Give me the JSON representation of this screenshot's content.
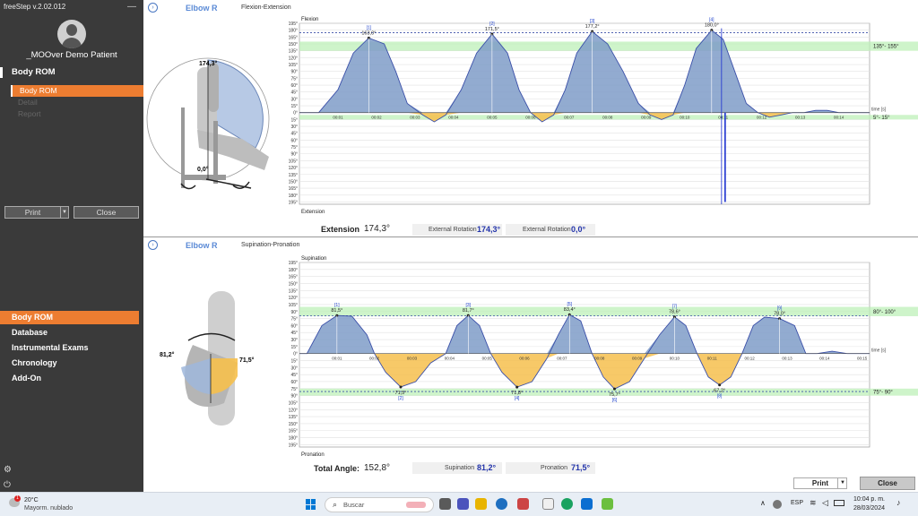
{
  "app": {
    "title": "freeStep v.2.02.012",
    "collapse_glyph": "—"
  },
  "sidebar": {
    "patient_name": "_MOOver Demo Patient",
    "section_title": "Body ROM",
    "sub_items": [
      {
        "label": "Body ROM",
        "active": true
      },
      {
        "label": "Detail",
        "active": false
      },
      {
        "label": "Report",
        "active": false
      }
    ],
    "print_label": "Print",
    "close_label": "Close",
    "nav": [
      {
        "label": "Body ROM",
        "active": true
      },
      {
        "label": "Database",
        "active": false
      },
      {
        "label": "Instrumental Exams",
        "active": false
      },
      {
        "label": "Chronology",
        "active": false
      },
      {
        "label": "Add-On",
        "active": false
      }
    ],
    "icons": [
      "settings-icon",
      "power-icon"
    ]
  },
  "charts": {
    "top": {
      "joint": "Elbow R",
      "subtitle": "Flexion-Extension",
      "avatar_labels": {
        "max": "174,3°",
        "min": "0,0°"
      },
      "summary": {
        "main_label": "Extension",
        "main_value": "174,3°",
        "a_label": "External Rotation",
        "a_value": "174,3°",
        "b_label": "External Rotation",
        "b_value": "0,0°"
      }
    },
    "bottom": {
      "joint": "Elbow R",
      "subtitle": "Supination-Pronation",
      "avatar_labels": {
        "left": "81,2°",
        "right": "71,5°"
      },
      "summary": {
        "main_label": "Total Angle:",
        "main_value": "152,8°",
        "a_label": "Supination",
        "a_value": "81,2°",
        "b_label": "Pronation",
        "b_value": "71,5°"
      }
    }
  },
  "chart_data": [
    {
      "type": "area",
      "title": "Flexion-Extension",
      "ylabel_top": "Flexion",
      "ylabel_bottom": "Extension",
      "xlabel": "time [s]",
      "ylim": [
        -200,
        195
      ],
      "y_ticks": [
        195,
        180,
        165,
        150,
        135,
        120,
        105,
        90,
        75,
        60,
        45,
        30,
        15,
        0,
        -15,
        -30,
        -45,
        -60,
        -75,
        -90,
        -105,
        -120,
        -135,
        -150,
        -165,
        -180,
        -195
      ],
      "y_tick_labels": [
        "195°",
        "180°",
        "165°",
        "150°",
        "135°",
        "120°",
        "105°",
        "90°",
        "75°",
        "60°",
        "45°",
        "30°",
        "15°",
        "0°",
        "15°",
        "30°",
        "45°",
        "60°",
        "75°",
        "90°",
        "105°",
        "120°",
        "135°",
        "150°",
        "165°",
        "180°",
        "195°"
      ],
      "x_ticks": [
        "00:01",
        "00:02",
        "00:03",
        "00:04",
        "00:05",
        "00:06",
        "00:07",
        "00:08",
        "00:09",
        "00:10",
        "00:11",
        "00:12",
        "00:13",
        "00:14"
      ],
      "xlim": [
        0,
        14.8
      ],
      "normal_bands": [
        {
          "label": "135°- 155°",
          "range": [
            135,
            155
          ]
        },
        {
          "label": "5°- 15°",
          "range": [
            -15,
            -5
          ]
        }
      ],
      "reference_line": 174.3,
      "series": [
        {
          "t": [
            0,
            0.5,
            1,
            1.4,
            1.8,
            2.2,
            2.5,
            2.8,
            3.2,
            3.5,
            3.8,
            4.2,
            4.6,
            5.0,
            5.4,
            5.7,
            6.0,
            6.3,
            6.6,
            6.9,
            7.2,
            7.6,
            8.0,
            8.4,
            8.8,
            9.1,
            9.4,
            9.7,
            10.0,
            10.3,
            10.7,
            11.0,
            11.3,
            11.6,
            11.9,
            12.2,
            12.5,
            12.8,
            13.1,
            13.4,
            13.7,
            14.0,
            14.4,
            14.8
          ],
          "v": [
            0,
            0,
            50,
            130,
            163,
            150,
            90,
            20,
            -5,
            -20,
            -5,
            50,
            130,
            171.5,
            130,
            50,
            0,
            -20,
            -5,
            50,
            130,
            177.2,
            150,
            90,
            20,
            -5,
            -15,
            -5,
            60,
            140,
            180,
            160,
            90,
            20,
            0,
            -10,
            -5,
            0,
            0,
            5,
            5,
            0,
            0,
            0
          ]
        }
      ],
      "peak_labels": [
        {
          "idx": "[1]",
          "t": 1.8,
          "value": "163,0°"
        },
        {
          "idx": "[2]",
          "t": 5.0,
          "value": "171,5°"
        },
        {
          "idx": "[3]",
          "t": 7.6,
          "value": "177,2°"
        },
        {
          "idx": "[4]",
          "t": 10.7,
          "value": "180,0°"
        }
      ],
      "spike": {
        "t": 11.05,
        "value": -195
      }
    },
    {
      "type": "area",
      "title": "Supination-Pronation",
      "ylabel_top": "Supination",
      "ylabel_bottom": "Pronation",
      "xlabel": "time [s]",
      "ylim": [
        -200,
        195
      ],
      "y_ticks": [
        195,
        180,
        165,
        150,
        135,
        120,
        105,
        90,
        75,
        60,
        45,
        30,
        15,
        0,
        -15,
        -30,
        -45,
        -60,
        -75,
        -90,
        -105,
        -120,
        -135,
        -150,
        -165,
        -180,
        -195
      ],
      "y_tick_labels": [
        "195°",
        "180°",
        "165°",
        "150°",
        "135°",
        "120°",
        "105°",
        "90°",
        "75°",
        "60°",
        "45°",
        "30°",
        "15°",
        "0°",
        "15°",
        "30°",
        "45°",
        "60°",
        "75°",
        "90°",
        "105°",
        "120°",
        "135°",
        "150°",
        "165°",
        "180°",
        "195°"
      ],
      "x_ticks": [
        "00:01",
        "00:02",
        "00:03",
        "00:04",
        "00:05",
        "00:06",
        "00:07",
        "00:08",
        "00:09",
        "00:10",
        "00:11",
        "00:12",
        "00:13",
        "00:14",
        "00:15"
      ],
      "xlim": [
        0,
        15.2
      ],
      "normal_bands": [
        {
          "label": "80°- 100°",
          "range": [
            80,
            100
          ]
        },
        {
          "label": "75°- 90°",
          "range": [
            -90,
            -75
          ]
        }
      ],
      "reference_line": 81.2,
      "series": [
        {
          "t": [
            0,
            0.2,
            0.6,
            1.0,
            1.4,
            1.8,
            2.0,
            2.3,
            2.7,
            3.1,
            3.5,
            3.9,
            4.2,
            4.5,
            4.8,
            5.1,
            5.4,
            5.8,
            6.2,
            6.6,
            6.9,
            7.2,
            7.5,
            7.8,
            8.1,
            8.4,
            8.8,
            9.2,
            9.6,
            10.0,
            10.3,
            10.6,
            10.9,
            11.2,
            11.5,
            11.8,
            12.1,
            12.4,
            12.8,
            13.2,
            13.5,
            13.8,
            14.2,
            14.6,
            15.2
          ],
          "v": [
            0,
            0,
            60,
            81.5,
            80,
            40,
            0,
            -40,
            -71.5,
            -60,
            -20,
            0,
            60,
            81.7,
            60,
            0,
            -40,
            -71.8,
            -60,
            -10,
            40,
            83.4,
            70,
            0,
            -50,
            -75.7,
            -60,
            -10,
            40,
            78.6,
            60,
            0,
            -50,
            -67.2,
            -50,
            0,
            60,
            78,
            75,
            60,
            0,
            0,
            5,
            0,
            0
          ]
        }
      ],
      "peak_labels": [
        {
          "idx": "[1]",
          "t": 1.0,
          "value": "81,5°",
          "pos": "top"
        },
        {
          "idx": "[3]",
          "t": 4.5,
          "value": "81,7°",
          "pos": "top"
        },
        {
          "idx": "[5]",
          "t": 7.2,
          "value": "83,4°",
          "pos": "top"
        },
        {
          "idx": "[7]",
          "t": 10.0,
          "value": "78,6°",
          "pos": "top"
        },
        {
          "idx": "[9]",
          "t": 12.8,
          "value": "78,0°",
          "pos": "top"
        },
        {
          "idx": "[2]",
          "t": 2.7,
          "value": "71,5°",
          "pos": "bottom"
        },
        {
          "idx": "[4]",
          "t": 5.8,
          "value": "71,8°",
          "pos": "bottom"
        },
        {
          "idx": "[6]",
          "t": 8.4,
          "value": "75,7°",
          "pos": "bottom"
        },
        {
          "idx": "[8]",
          "t": 11.2,
          "value": "67,2°",
          "pos": "bottom"
        }
      ]
    }
  ],
  "main_buttons": {
    "print": "Print",
    "close": "Close"
  },
  "taskbar": {
    "weather_temp": "20°C",
    "weather_desc": "Mayorm. nublado",
    "weather_badge": "1",
    "search_placeholder": "Buscar",
    "language": "ESP",
    "time": "10:04 p. m.",
    "date": "28/03/2024",
    "app_colors": [
      "#5a5a5a",
      "#e8b400",
      "#1e6fc0",
      "#2a9d8f",
      "#cc4444",
      "#0a6ed1",
      "#1aa260",
      "#7a7a7a",
      "#3a7bd5",
      "#6cbf3f"
    ]
  },
  "colors": {
    "accent": "#ed7d31",
    "sidebar": "#3a3a3a",
    "positive_fill": "#7f9cc8",
    "negative_fill": "#f6c04d",
    "band": "#b9f0b3",
    "line": "#3a4fa8"
  }
}
